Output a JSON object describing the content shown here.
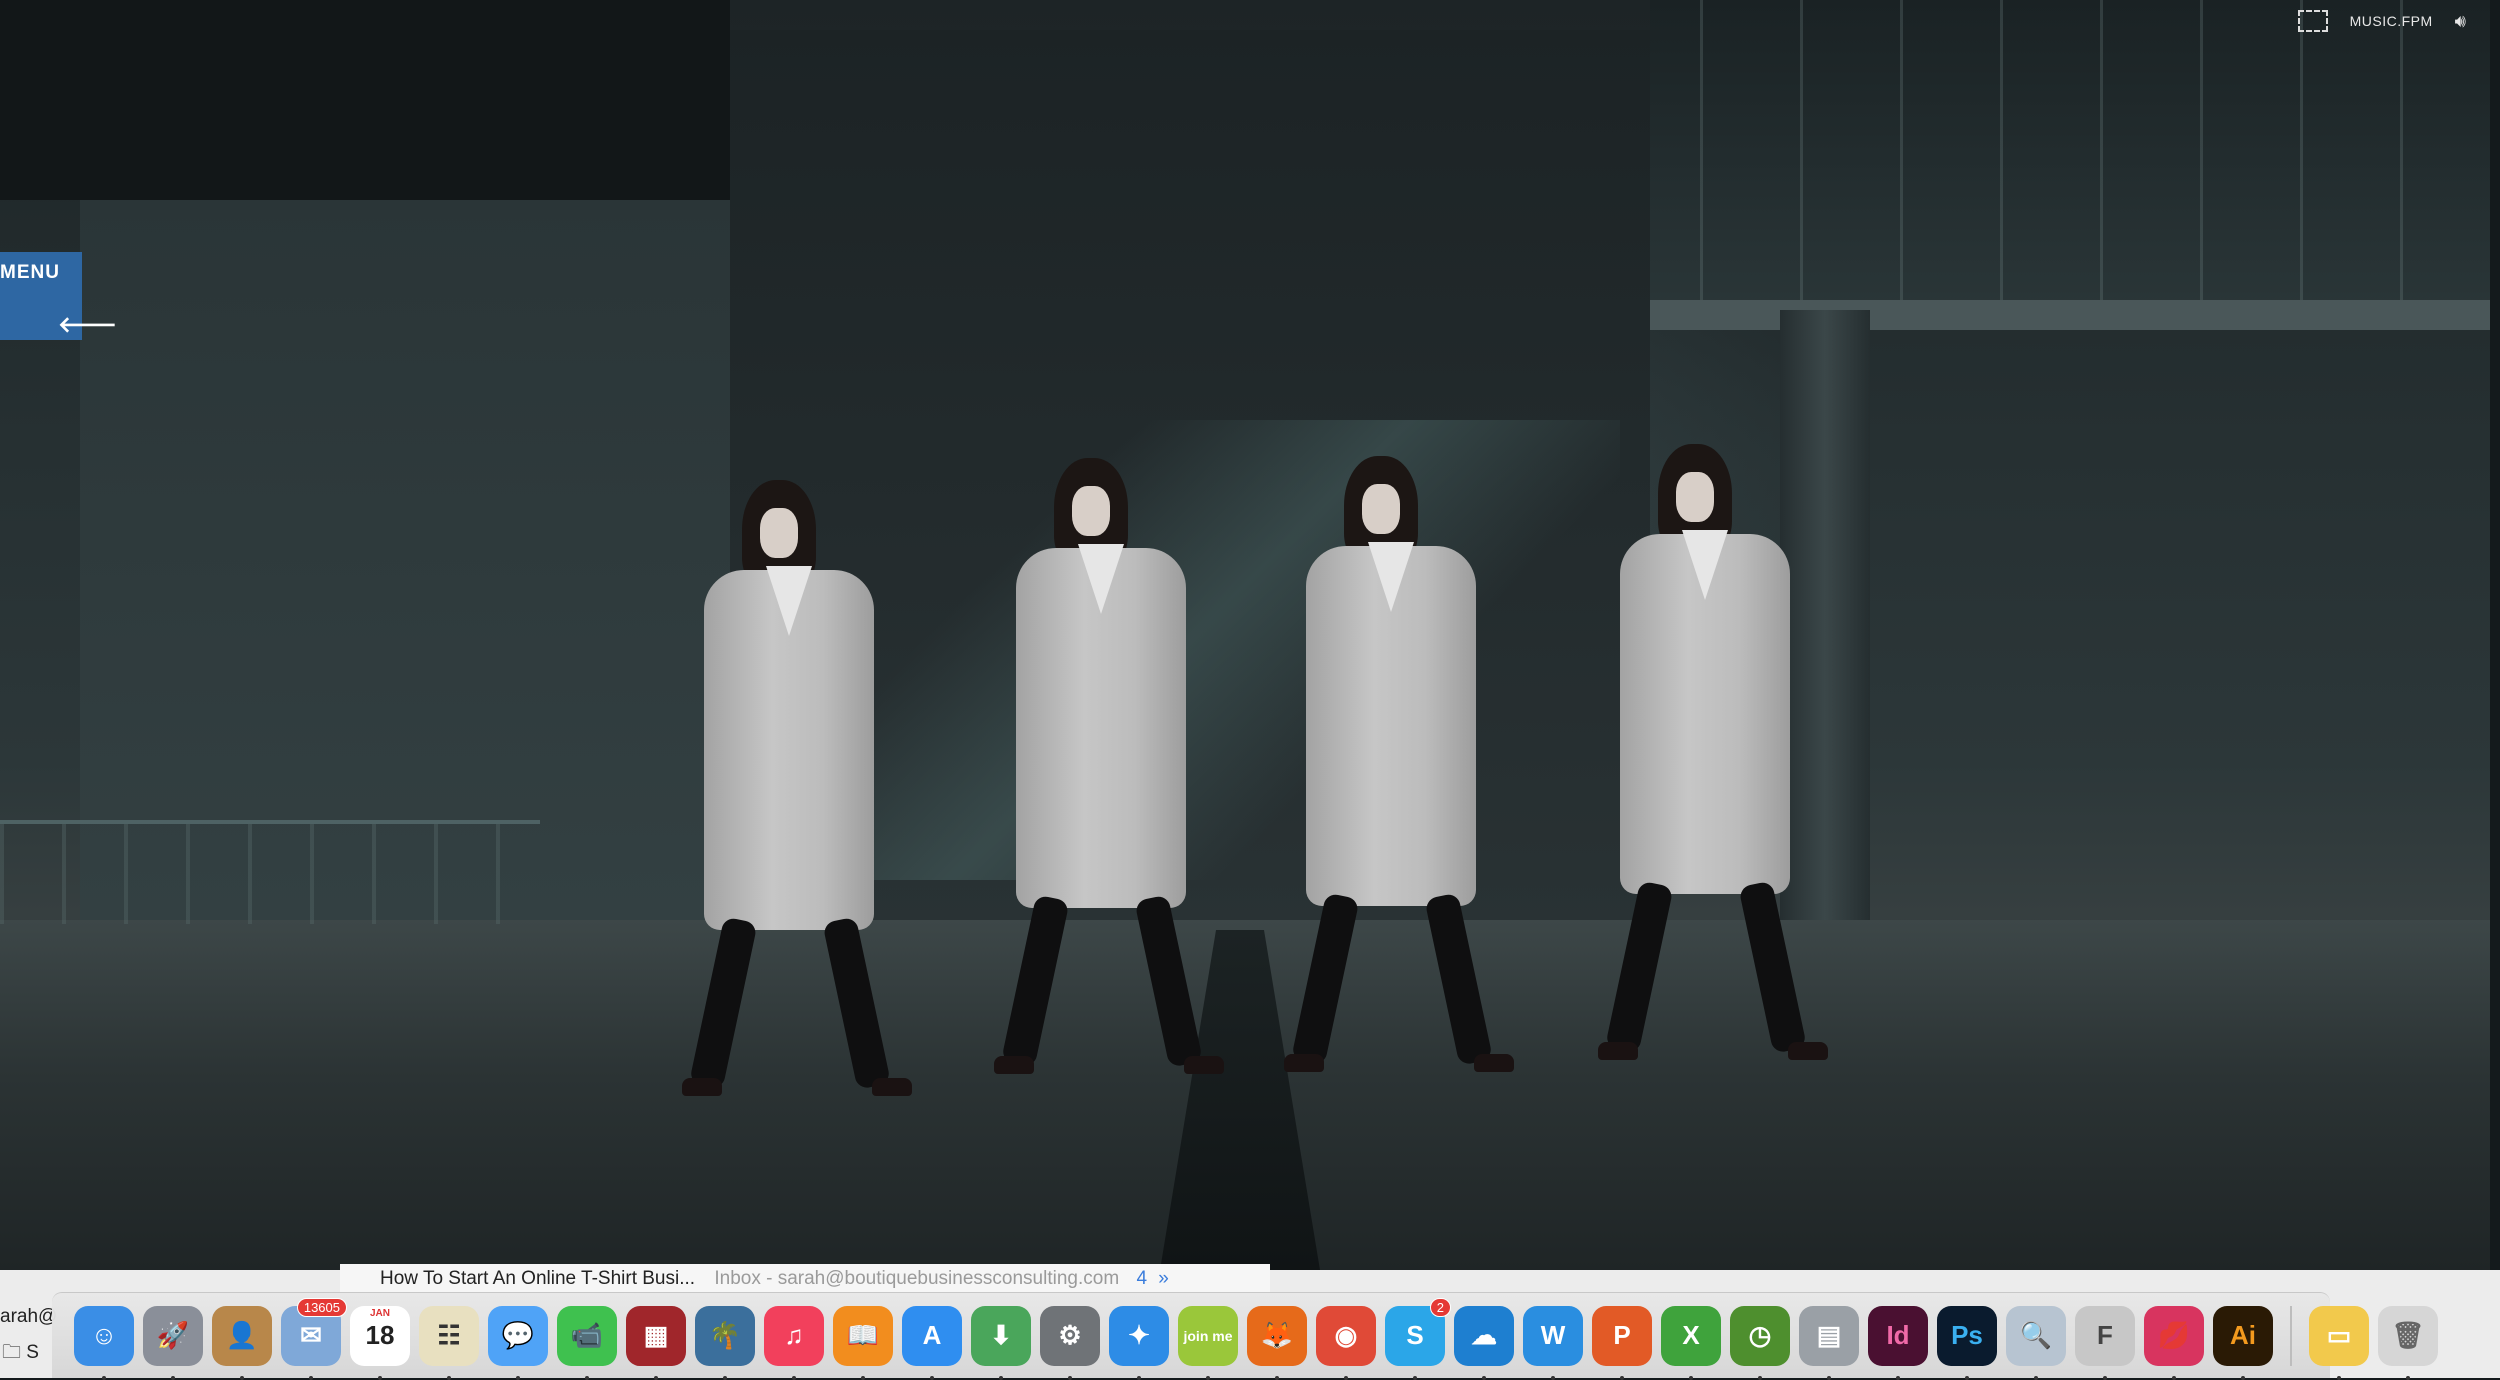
{
  "video": {
    "menu_label": "MENU",
    "back_arrow_icon": "arrow-left-icon",
    "music_label": "MUSIC.FPM",
    "fullscreen_icon": "fullscreen-icon",
    "volume_icon": "volume-icon"
  },
  "background_window": {
    "mail_subject": "How To Start An Online T-Shirt Busi...",
    "mail_meta": "Inbox - sarah@boutiquebusinessconsulting.com",
    "mail_count": "4",
    "sidebar_text_1": "arah@",
    "sidebar_text_2": "S"
  },
  "dock": {
    "items": [
      {
        "name": "finder-icon",
        "glyph": "☺",
        "color": "#3a8ee6"
      },
      {
        "name": "launchpad-icon",
        "glyph": "🚀",
        "color": "#8a8f99"
      },
      {
        "name": "contacts-icon",
        "glyph": "👤",
        "color": "#b8874a"
      },
      {
        "name": "mail-icon",
        "glyph": "✉",
        "color": "#7fa8d8",
        "badge": "13605"
      },
      {
        "name": "calendar-icon",
        "glyph": "18",
        "color": "#ffffff",
        "text_color": "#222",
        "top": "JAN"
      },
      {
        "name": "preview-icon",
        "glyph": "☷",
        "color": "#e8e0c0",
        "text_color": "#333"
      },
      {
        "name": "messages-icon",
        "glyph": "💬",
        "color": "#4fa3f7"
      },
      {
        "name": "facetime-icon",
        "glyph": "📹",
        "color": "#3fc14f"
      },
      {
        "name": "photo-booth-icon",
        "glyph": "▦",
        "color": "#a0262b"
      },
      {
        "name": "iphoto-icon",
        "glyph": "🌴",
        "color": "#3b6f9c"
      },
      {
        "name": "itunes-icon",
        "glyph": "♫",
        "color": "#f2405c"
      },
      {
        "name": "ibooks-icon",
        "glyph": "📖",
        "color": "#f28d1e"
      },
      {
        "name": "app-store-icon",
        "glyph": "A",
        "color": "#2f8ef0"
      },
      {
        "name": "downloader-icon",
        "glyph": "⬇",
        "color": "#4aa65b"
      },
      {
        "name": "system-preferences-icon",
        "glyph": "⚙",
        "color": "#6f7377"
      },
      {
        "name": "safari-icon",
        "glyph": "✦",
        "color": "#2d8ce6"
      },
      {
        "name": "join-me-icon",
        "glyph": "join me",
        "color": "#9ac73a"
      },
      {
        "name": "firefox-icon",
        "glyph": "🦊",
        "color": "#e66a1a"
      },
      {
        "name": "chrome-icon",
        "glyph": "◉",
        "color": "#e04a37"
      },
      {
        "name": "skype-icon",
        "glyph": "S",
        "color": "#2ba6e8",
        "badge": "2"
      },
      {
        "name": "lacie-icon",
        "glyph": "☁",
        "color": "#1e7fd0"
      },
      {
        "name": "word-icon",
        "glyph": "W",
        "color": "#2a8ee0"
      },
      {
        "name": "powerpoint-icon",
        "glyph": "P",
        "color": "#e25a26"
      },
      {
        "name": "excel-icon",
        "glyph": "X",
        "color": "#3fa33c"
      },
      {
        "name": "time-machine-icon",
        "glyph": "◷",
        "color": "#4e8f2e"
      },
      {
        "name": "disk-utility-icon",
        "glyph": "▤",
        "color": "#9aa0a6"
      },
      {
        "name": "indesign-icon",
        "glyph": "Id",
        "color": "#4a1031",
        "text_color": "#f06aa8"
      },
      {
        "name": "photoshop-icon",
        "glyph": "Ps",
        "color": "#0a1b2e",
        "text_color": "#3ab0f0"
      },
      {
        "name": "image-capture-icon",
        "glyph": "🔍",
        "color": "#b7c4d1"
      },
      {
        "name": "font-book-icon",
        "glyph": "F",
        "color": "#c7c7c7",
        "text_color": "#444"
      },
      {
        "name": "kiss-app-icon",
        "glyph": "💋",
        "color": "#d8345f"
      },
      {
        "name": "illustrator-icon",
        "glyph": "Ai",
        "color": "#2a1a05",
        "text_color": "#f39a1e"
      },
      {
        "name": "documents-stack-icon",
        "glyph": "▭",
        "color": "#f2c94c",
        "separator_before": true
      },
      {
        "name": "trash-icon",
        "glyph": "🗑",
        "color": "#d6d6d6",
        "text_color": "#666"
      }
    ]
  }
}
